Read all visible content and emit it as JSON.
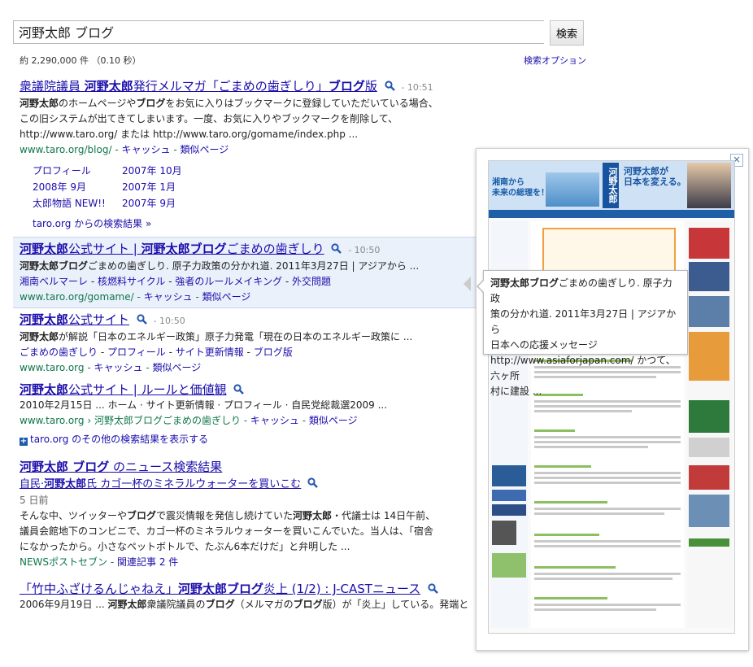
{
  "search": {
    "query": "河野太郎 ブログ",
    "button_label": "検索"
  },
  "stats": "約 2,290,000 件 （0.10 秒）",
  "search_options": "検索オプション",
  "results": [
    {
      "title_pre": "衆議院議員 ",
      "title_bold": "河野太郎",
      "title_post": "発行メルマガ「ごまめの歯ぎしり」",
      "title_bold2": "ブログ",
      "title_post2": "版",
      "time": "- 10:51",
      "snippet_line1_b1": "河野太郎",
      "snippet_line1": "のホームページや",
      "snippet_line1_b2": "ブログ",
      "snippet_line1_post": "をお気に入りはブックマークに登録していただいている場合、",
      "snippet_line2": "この旧システムが出てきてしまいます。一度、お気に入りやブックマークを削除して、",
      "snippet_line3": "http://www.taro.org/ または  http://www.taro.org/gomame/index.php ...",
      "url": "www.taro.org/blog/",
      "cache": "キャッシュ",
      "similar": "類似ページ",
      "sitelinks": [
        "プロフィール",
        "2007年 10月",
        "2008年 9月",
        "2007年 1月",
        "太郎物語 NEW!!",
        "2007年 9月"
      ],
      "more": "taro.org からの検索結果 »"
    },
    {
      "title_bold": "河野太郎",
      "title_post": "公式サイト | ",
      "title_bold2": "河野太郎ブログ",
      "title_post2": "ごまめの歯ぎしり",
      "time": "- 10:50",
      "snippet_b1": "河野太郎ブログ",
      "snippet": "ごまめの歯ぎしり. 原子力政策の分かれ道. 2011年3月27日 | アジアから ...",
      "links": [
        "湘南ベルマーレ",
        "核燃料サイクル",
        "強者のルールメイキング",
        "外交問題"
      ],
      "url": "www.taro.org/gomame/",
      "cache": "キャッシュ",
      "similar": "類似ページ"
    },
    {
      "title_bold": "河野太郎",
      "title_post": "公式サイト",
      "time": "- 10:50",
      "snippet_b1": "河野太郎",
      "snippet": "が解説「日本のエネルギー政策」原子力発電「現在の日本のエネルギー政策に ...",
      "links": [
        "ごまめの歯ぎしり",
        "プロフィール",
        "サイト更新情報",
        "ブログ版"
      ],
      "url": "www.taro.org",
      "cache": "キャッシュ",
      "similar": "類似ページ"
    },
    {
      "title_bold": "河野太郎",
      "title_post": "公式サイト | ルールと価値観",
      "snippet": "2010年2月15日 ... ホーム · サイト更新情報 · プロフィール · 自民党総裁選2009 ...",
      "url": "www.taro.org › 河野太郎ブログごまめの歯ぎしり",
      "cache": "キャッシュ",
      "similar": "類似ページ",
      "more": "taro.org のその他の検索結果を表示する"
    }
  ],
  "news": {
    "heading_bold": "河野太郎 ブログ",
    "heading_post": " のニュース検索結果",
    "item_title_pre": "自民·",
    "item_title_bold": "河野太郎",
    "item_title_post": "氏 カゴ一杯のミネラルウォーターを買いこむ",
    "date": "5 日前",
    "line1_pre": "そんな中、ツイッターや",
    "line1_bold": "ブログ",
    "line1_mid": "で震災情報を発信し続けていた",
    "line1_bold2": "河野太郎",
    "line1_post": "・代議士は 14日午前、",
    "line2": "議員会館地下のコンビニで、カゴ一杯のミネラルウォーターを買いこんでいた。当人は、「宿舎",
    "line3": "になかったから。小さなペットボトルで、たぶん6本だけだ」と弁明した ...",
    "source": "NEWSポストセブン",
    "related": "関連記事 2 件"
  },
  "last_result": {
    "title_pre": "「竹中ふざけるんじゃねえ」",
    "title_bold": "河野太郎ブログ",
    "title_post": "炎上 (1/2) : J-CASTニュース",
    "line1_pre": "2006年9月19日 ... ",
    "line1_bold": "河野太郎",
    "line1_mid": "衆議院議員の",
    "line1_bold2": "ブログ",
    "line1_mid2": "（メルマガの",
    "line1_bold3": "ブログ",
    "line1_post": "版）が「炎上」している。発端と"
  },
  "preview": {
    "tooltip_bold": "河野太郎ブログ",
    "tooltip_line1": "ごまめの歯ぎしり. 原子力政",
    "tooltip_line2": "策の分かれ道. 2011年3月27日 | アジアから",
    "tooltip_line3": "日本への応援メッセージ",
    "tooltip_line4": "http://www.asiaforjapan.com/ かつて、六ヶ所",
    "tooltip_line5": "村に建設 ...",
    "banner_left": "湘南から\n未来の総理を！",
    "banner_name": "河野太郎",
    "banner_slogan": "河野太郎が\n日本を変える。",
    "close_icon": "×"
  },
  "colors": {
    "link": "#1a0dab",
    "url": "#0e774a",
    "highlight": "#ebf1fb"
  }
}
